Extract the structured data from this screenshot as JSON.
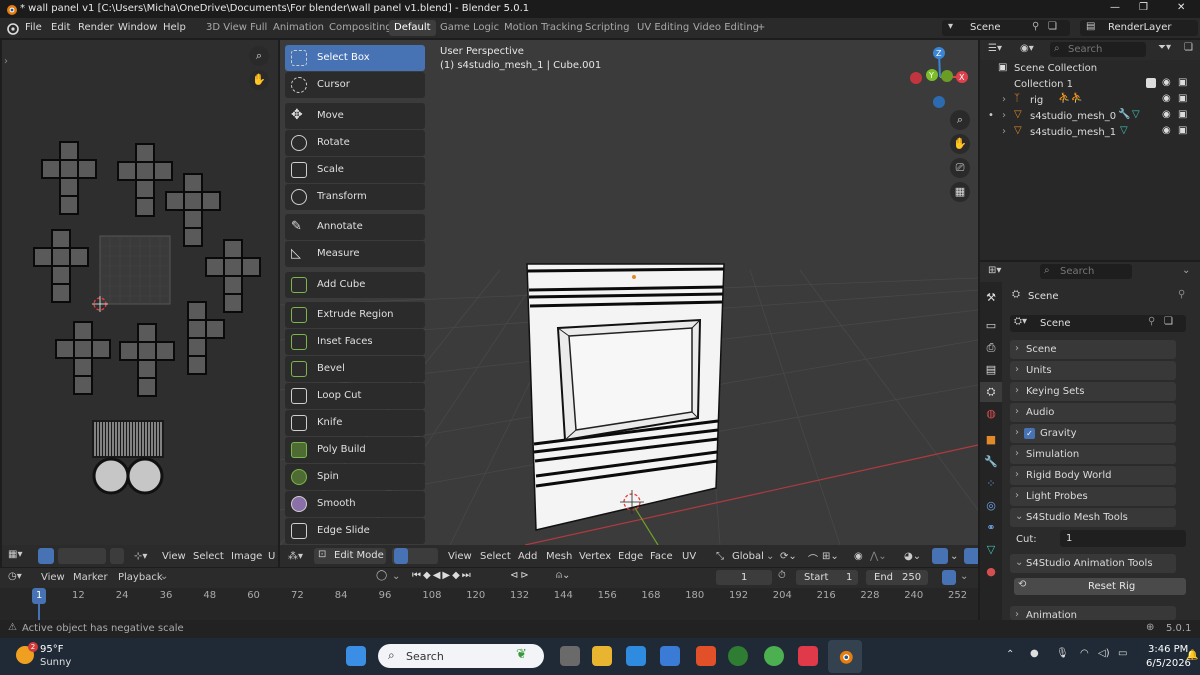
{
  "window": {
    "title": "* wall panel v1 [C:\\Users\\Micha\\OneDrive\\Documents\\For blender\\wall panel v1.blend] - Blender 5.0.1",
    "minimize": "—",
    "maximize": "❐",
    "close": "✕"
  },
  "menu": [
    "File",
    "Edit",
    "Render",
    "Window",
    "Help"
  ],
  "workspaces": [
    "3D View Full",
    "Animation",
    "Compositing",
    "Default",
    "Game Logic",
    "Motion Tracking",
    "Scripting",
    "UV Editing",
    "Video Editing"
  ],
  "workspace_active": "Default",
  "workspace_add": "+",
  "scene_name": "Scene",
  "view_layer": "RenderLayer",
  "uv_editor": {
    "header": [
      "View",
      "Select",
      "Image",
      "U"
    ]
  },
  "viewport": {
    "perspective": "User Perspective",
    "object": "(1) s4studio_mesh_1 | Cube.001",
    "tools": [
      "Select Box",
      "Cursor",
      "Move",
      "Rotate",
      "Scale",
      "Transform",
      "Annotate",
      "Measure",
      "Add Cube",
      "Extrude Region",
      "Inset Faces",
      "Bevel",
      "Loop Cut",
      "Knife",
      "Poly Build",
      "Spin",
      "Smooth",
      "Edge Slide"
    ],
    "active_tool": "Select Box",
    "gizmo": {
      "x": "X",
      "y": "Y",
      "z": "Z"
    },
    "header": {
      "mode": "Edit Mode",
      "menus": [
        "View",
        "Select",
        "Add",
        "Mesh",
        "Vertex",
        "Edge",
        "Face",
        "UV"
      ],
      "orientation": "Global"
    }
  },
  "outliner": {
    "search_placeholder": "Search",
    "rows": [
      {
        "label": "Scene Collection"
      },
      {
        "label": "Collection 1"
      },
      {
        "label": "rig"
      },
      {
        "label": "s4studio_mesh_0"
      },
      {
        "label": "s4studio_mesh_1"
      }
    ]
  },
  "properties": {
    "search_placeholder": "Search",
    "context": "Scene",
    "scene_field": "Scene",
    "panels": [
      "Scene",
      "Units",
      "Keying Sets",
      "Audio",
      "Gravity",
      "Simulation",
      "Rigid Body World",
      "Light Probes"
    ],
    "gravity_checked": true,
    "s4_mesh_tools": "S4Studio Mesh Tools",
    "cut_label": "Cut:",
    "cut_value": "1",
    "s4_anim_tools": "S4Studio Animation Tools",
    "reset_rig": "Reset Rig",
    "animation": "Animation"
  },
  "timeline": {
    "menus": [
      "View",
      "Marker",
      "Playback"
    ],
    "current_frame": "1",
    "start_label": "Start",
    "start": "1",
    "end_label": "End",
    "end": "250",
    "ticks": [
      "1",
      "12",
      "24",
      "36",
      "48",
      "60",
      "72",
      "84",
      "96",
      "108",
      "120",
      "132",
      "144",
      "156",
      "168",
      "180",
      "192",
      "204",
      "216",
      "228",
      "240",
      "252"
    ]
  },
  "status": {
    "message": "Active object has negative scale",
    "version": "5.0.1"
  },
  "taskbar": {
    "weather_temp": "95°F",
    "weather_desc": "Sunny",
    "weather_badge": "2",
    "search": "Search",
    "time": "3:46 PM",
    "date": "6/5/2026"
  },
  "colors": {
    "accent": "#4772b3",
    "axis_x": "#e0404c",
    "axis_y": "#7dbd2c",
    "axis_z": "#3a85d6",
    "viewport_bg": "#3b3b3b"
  }
}
